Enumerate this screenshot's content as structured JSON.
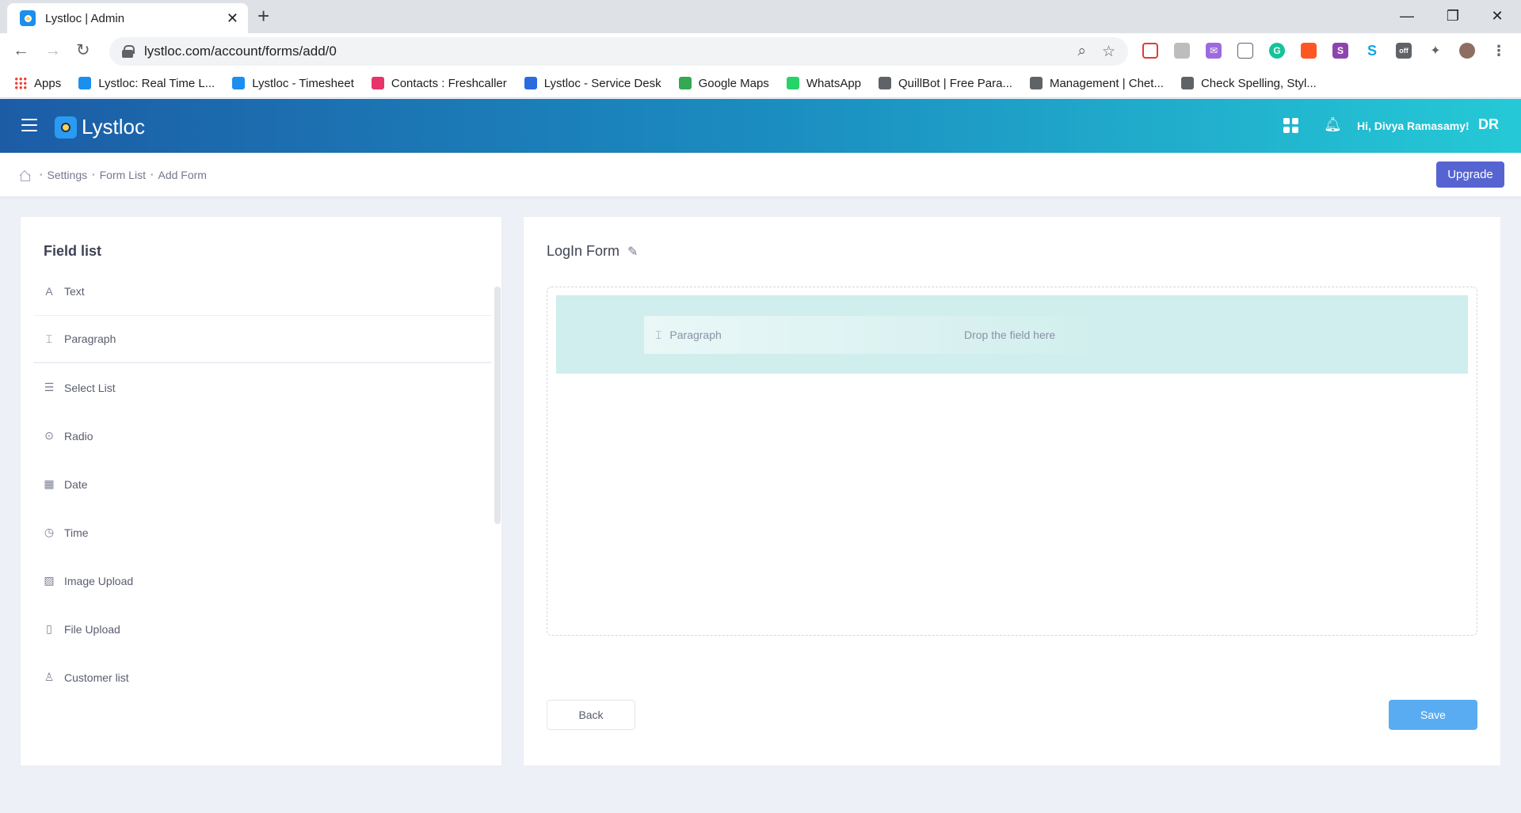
{
  "browser": {
    "tab_title": "Lystloc | Admin",
    "url": "lystloc.com/account/forms/add/0",
    "bookmarks": [
      {
        "label": "Apps",
        "color": "#ea4335"
      },
      {
        "label": "Lystloc: Real Time L...",
        "color": "#1c8ef0"
      },
      {
        "label": "Lystloc - Timesheet",
        "color": "#1c8ef0"
      },
      {
        "label": "Contacts : Freshcaller",
        "color": "#e8336b"
      },
      {
        "label": "Lystloc - Service Desk",
        "color": "#2a6be0"
      },
      {
        "label": "Google Maps",
        "color": "#34a853"
      },
      {
        "label": "WhatsApp",
        "color": "#25d366"
      },
      {
        "label": "QuillBot | Free Para...",
        "color": "#5f6368"
      },
      {
        "label": "Management | Chet...",
        "color": "#5f6368"
      },
      {
        "label": "Check Spelling, Styl...",
        "color": "#5f6368"
      }
    ]
  },
  "app": {
    "brand": "Lystloc",
    "greeting": "Hi, Divya Ramasamy!",
    "initials": "DR"
  },
  "breadcrumb": {
    "items": [
      "Settings",
      "Form List",
      "Add Form"
    ]
  },
  "upgrade_label": "Upgrade",
  "field_list": {
    "title": "Field list",
    "items": [
      {
        "label": "Text",
        "icon": "text-icon"
      },
      {
        "label": "Paragraph",
        "icon": "paragraph-icon"
      },
      {
        "label": "Select List",
        "icon": "list-icon"
      },
      {
        "label": "Radio",
        "icon": "radio-icon"
      },
      {
        "label": "Date",
        "icon": "calendar-icon"
      },
      {
        "label": "Time",
        "icon": "clock-icon"
      },
      {
        "label": "Image Upload",
        "icon": "image-icon"
      },
      {
        "label": "File Upload",
        "icon": "file-icon"
      },
      {
        "label": "Customer list",
        "icon": "user-icon"
      }
    ]
  },
  "form": {
    "title": "LogIn Form",
    "dragging_field": "Paragraph",
    "drop_hint": "Drop the field here",
    "back_label": "Back",
    "save_label": "Save"
  }
}
